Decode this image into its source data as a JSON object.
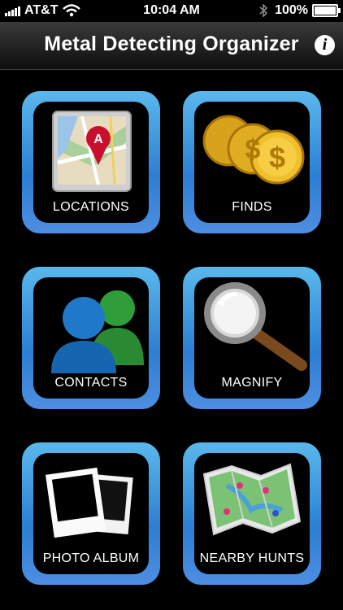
{
  "status_bar": {
    "carrier": "AT&T",
    "time": "10:04 AM",
    "battery": "100%",
    "icons": [
      "signal-bars-icon",
      "wifi-icon",
      "bluetooth-icon",
      "battery-icon"
    ]
  },
  "navbar": {
    "title": "Metal Detecting Organizer",
    "info_label": "i"
  },
  "tiles": [
    {
      "label": "LOCATIONS",
      "icon": "map-pin-icon"
    },
    {
      "label": "FINDS",
      "icon": "gold-coins-icon"
    },
    {
      "label": "CONTACTS",
      "icon": "people-icon"
    },
    {
      "label": "MAGNIFY",
      "icon": "magnifying-glass-icon"
    },
    {
      "label": "PHOTO ALBUM",
      "icon": "photo-frames-icon"
    },
    {
      "label": "NEARBY HUNTS",
      "icon": "folded-map-icon"
    }
  ],
  "colors": {
    "tile_border": "#3b8fe0",
    "background": "#000000"
  }
}
